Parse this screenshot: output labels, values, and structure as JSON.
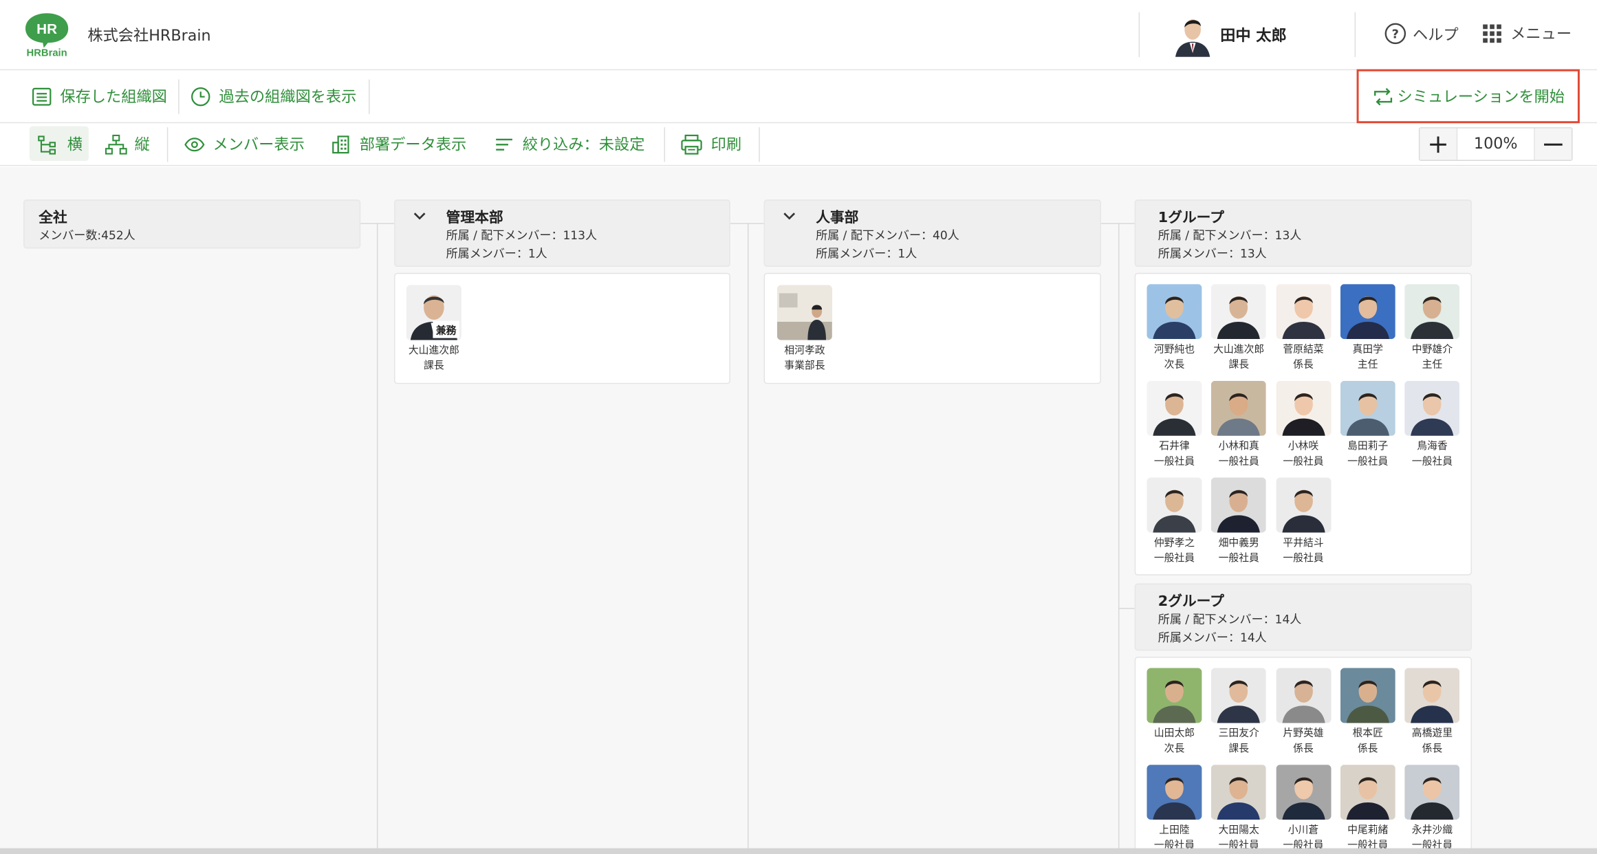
{
  "header": {
    "company": "株式会社HRBrain",
    "logo_text_top": "HR",
    "logo_text_bottom": "HRBrain",
    "user_name": "田中 太郎",
    "help_label": "ヘルプ",
    "menu_label": "メニュー"
  },
  "toolbar": {
    "saved_label": "保存した組織図",
    "past_label": "過去の組織図を表示",
    "simulation_label": "シミュレーションを開始"
  },
  "view_toolbar": {
    "horizontal": "横",
    "vertical": "縦",
    "members": "メンバー表示",
    "dept_data": "部署データ表示",
    "filter": "絞り込み：未設定",
    "print": "印刷",
    "zoom": "100%"
  },
  "colors": {
    "accent": "#2f8f3a",
    "highlight": "#e24733"
  },
  "org": {
    "root": {
      "title": "全社",
      "count": "メンバー数:452人"
    },
    "kanri": {
      "title": "管理本部",
      "sub1": "所属 / 配下メンバー：113人",
      "sub2": "所属メンバー：1人",
      "members": [
        {
          "name": "大山進次郎",
          "role": "課長",
          "badge": "兼務"
        }
      ]
    },
    "jinji": {
      "title": "人事部",
      "sub1": "所属 / 配下メンバー：40人",
      "sub2": "所属メンバー：1人",
      "members": [
        {
          "name": "相河孝政",
          "role": "事業部長"
        }
      ]
    },
    "g1": {
      "title": "1グループ",
      "sub1": "所属 / 配下メンバー：13人",
      "sub2": "所属メンバー：13人",
      "members": [
        {
          "name": "河野純也",
          "role": "次長"
        },
        {
          "name": "大山進次郎",
          "role": "課長"
        },
        {
          "name": "菅原結菜",
          "role": "係長"
        },
        {
          "name": "真田学",
          "role": "主任"
        },
        {
          "name": "中野雄介",
          "role": "主任"
        },
        {
          "name": "石井律",
          "role": "一般社員"
        },
        {
          "name": "小林和真",
          "role": "一般社員"
        },
        {
          "name": "小林咲",
          "role": "一般社員"
        },
        {
          "name": "島田莉子",
          "role": "一般社員"
        },
        {
          "name": "鳥海香",
          "role": "一般社員"
        },
        {
          "name": "仲野孝之",
          "role": "一般社員"
        },
        {
          "name": "畑中義男",
          "role": "一般社員"
        },
        {
          "name": "平井結斗",
          "role": "一般社員"
        }
      ]
    },
    "g2": {
      "title": "2グループ",
      "sub1": "所属 / 配下メンバー：14人",
      "sub2": "所属メンバー：14人",
      "members": [
        {
          "name": "山田太郎",
          "role": "次長"
        },
        {
          "name": "三田友介",
          "role": "課長"
        },
        {
          "name": "片野英雄",
          "role": "係長"
        },
        {
          "name": "根本匠",
          "role": "係長"
        },
        {
          "name": "高橋遊里",
          "role": "係長"
        },
        {
          "name": "上田陸",
          "role": "一般社員"
        },
        {
          "name": "大田陽太",
          "role": "一般社員"
        },
        {
          "name": "小川蒼",
          "role": "一般社員"
        },
        {
          "name": "中尾莉緒",
          "role": "一般社員"
        },
        {
          "name": "永井沙織",
          "role": "一般社員"
        }
      ]
    }
  }
}
